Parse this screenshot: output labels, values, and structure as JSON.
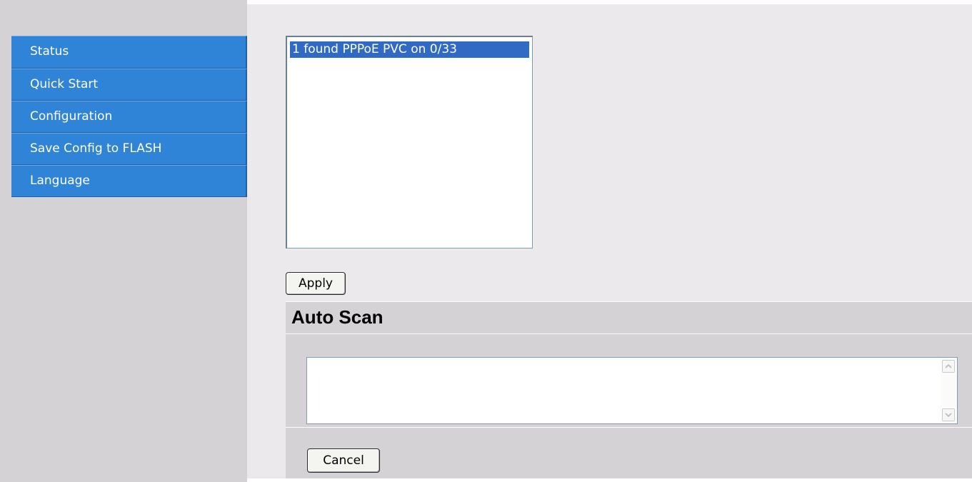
{
  "sidebar": {
    "items": [
      {
        "label": "Status"
      },
      {
        "label": "Quick Start"
      },
      {
        "label": "Configuration"
      },
      {
        "label": "Save Config to FLASH"
      },
      {
        "label": "Language"
      }
    ]
  },
  "pvc_list": {
    "options": [
      {
        "label": "1 found PPPoE PVC on 0/33",
        "selected": true
      }
    ]
  },
  "apply_button": {
    "label": "Apply"
  },
  "auto_scan": {
    "title": "Auto Scan",
    "log_value": "",
    "cancel_label": "Cancel"
  },
  "colors": {
    "nav_bg": "#2f84d8",
    "selected_option": "#316ac5",
    "sidebar_bg": "#d4d2d4",
    "page_bg": "#ece9ec"
  },
  "icons": {
    "scroll_up": "chevron-up-icon",
    "scroll_down": "chevron-down-icon"
  }
}
